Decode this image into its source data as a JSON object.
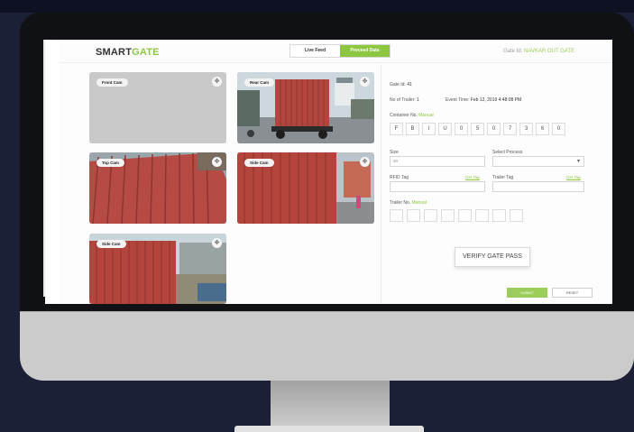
{
  "app": {
    "logo_smart": "SMART",
    "logo_gate": "GATE"
  },
  "tabs": [
    {
      "label": "Live Feed",
      "active": false
    },
    {
      "label": "Proceed Data",
      "active": true
    }
  ],
  "header": {
    "gate_id_label": "Gate Id:",
    "gate_id_value": "NAVKAR OUT GATE"
  },
  "cameras": [
    {
      "label": "Front Cam",
      "feed": "empty"
    },
    {
      "label": "Rear Cam",
      "feed": "container-truck"
    },
    {
      "label": "Top Cam",
      "feed": "container-roof"
    },
    {
      "label": "Side Cam",
      "feed": "container-side"
    },
    {
      "label": "Side Cam",
      "feed": "container-side"
    }
  ],
  "form": {
    "gate_id_label": "Gate Id:",
    "gate_id_value": "41",
    "trailer_count_label": "No of Trailer:",
    "trailer_count_value": "1",
    "event_time_label": "Event Time:",
    "event_time_value": "Feb 12, 2019 4:48:08 PM",
    "container_no_label": "Container No.",
    "manual_label": "Manual",
    "container_chars": [
      "F",
      "B",
      "I",
      "U",
      "0",
      "5",
      "0",
      "7",
      "3",
      "6",
      "0"
    ],
    "size_label": "Size",
    "size_value": "20",
    "select_process_label": "Select Process",
    "select_process_value": "",
    "rfid_label": "RFID Tag",
    "rfid_link": "Get Tag",
    "trailer_tag_label": "Trailer Tag",
    "trailer_tag_link": "Get Tag",
    "trailer_no_label": "Trailer No.",
    "trailer_manual_label": "Manual",
    "trailer_boxes": 8,
    "verify_button": "VERIFY GATE PASS",
    "submit_button": "SUBMIT",
    "reset_button": "RESET"
  },
  "colors": {
    "accent": "#8dc63f",
    "container_red": "#b2463f",
    "monitor_bezel": "#101114",
    "monitor_chin": "#cbcbcb"
  }
}
